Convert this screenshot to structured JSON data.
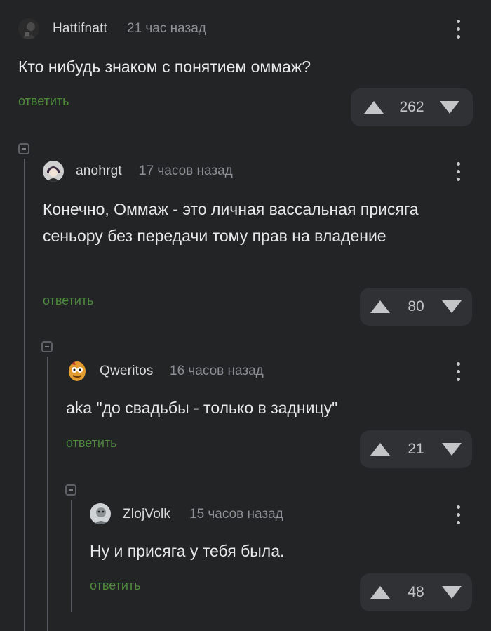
{
  "comments": [
    {
      "username": "Hattifnatt",
      "time": "21 час назад",
      "text": "Кто нибудь знаком с понятием оммаж?",
      "reply_label": "ответить",
      "votes": "262",
      "avatar_icon": "user-avatar-icon"
    },
    {
      "username": "anohrgt",
      "time": "17 часов назад",
      "text": "Конечно, Оммаж - это личная вассальная присяга сеньору без передачи тому прав на владение",
      "reply_label": "ответить",
      "votes": "80",
      "avatar_icon": "user-avatar-icon"
    },
    {
      "username": "Qweritos",
      "time": "16 часов назад",
      "text": "aka \"до свадьбы - только в задницу\"",
      "reply_label": "ответить",
      "votes": "21",
      "avatar_icon": "user-avatar-icon"
    },
    {
      "username": "ZlojVolk",
      "time": "15 часов назад",
      "text": "Ну и присяга у тебя была.",
      "reply_label": "ответить",
      "votes": "48",
      "avatar_icon": "user-avatar-icon"
    }
  ],
  "colors": {
    "background": "#222426",
    "reply_link": "#4f8a3d",
    "vote_box": "#2f3134",
    "thread_line": "#55585c"
  }
}
